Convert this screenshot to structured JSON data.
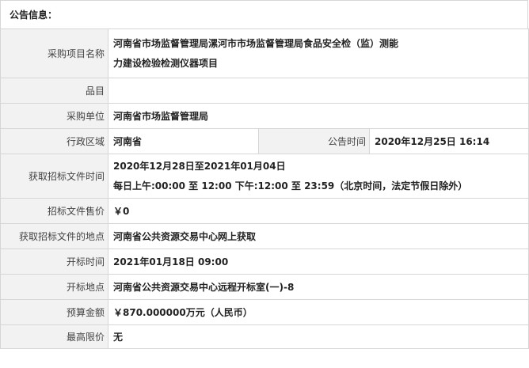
{
  "section_title": "公告信息：",
  "rows": {
    "project_name": {
      "label": "采购项目名称",
      "value_line1": "河南省市场监督管理局漯河市市场监督管理局食品安全检（监）测能",
      "value_line2": "力建设检验检测仪器项目"
    },
    "item": {
      "label": "品目",
      "value": ""
    },
    "purchaser": {
      "label": "采购单位",
      "value": "河南省市场监督管理局"
    },
    "region": {
      "label": "行政区域",
      "value": "河南省",
      "time_label": "公告时间",
      "time_value": "2020年12月25日 16:14"
    },
    "doc_time": {
      "label": "获取招标文件时间",
      "value_line1": "2020年12月28日至2021年01月04日",
      "value_line2": "每日上午:00:00 至 12:00   下午:12:00 至 23:59（北京时间，法定节假日除外）"
    },
    "doc_price": {
      "label": "招标文件售价",
      "value": "￥0"
    },
    "doc_place": {
      "label": "获取招标文件的地点",
      "value": "河南省公共资源交易中心网上获取"
    },
    "open_time": {
      "label": "开标时间",
      "value": "2021年01月18日 09:00"
    },
    "open_place": {
      "label": "开标地点",
      "value": "河南省公共资源交易中心远程开标室(一)-8"
    },
    "budget": {
      "label": "预算金额",
      "value": "￥870.000000万元（人民币）"
    },
    "max_price": {
      "label": "最高限价",
      "value": "无"
    }
  }
}
